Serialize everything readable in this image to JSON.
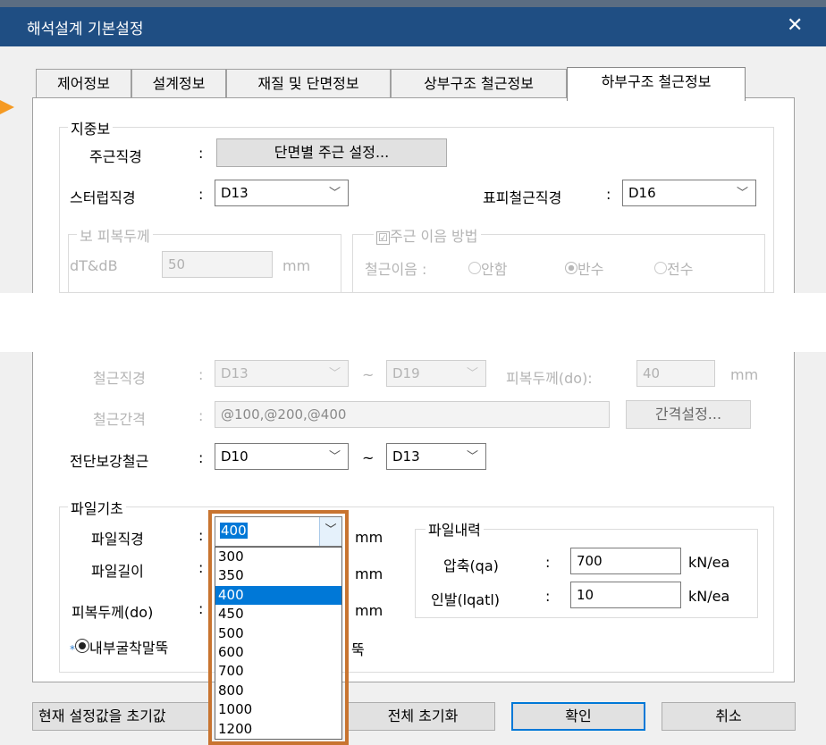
{
  "window": {
    "title": "해석설계 기본설정",
    "close_icon": "close-icon"
  },
  "tabs": [
    {
      "label": "제어정보"
    },
    {
      "label": "설계정보"
    },
    {
      "label": "재질 및 단면정보"
    },
    {
      "label": "상부구조 철근정보"
    },
    {
      "label": "하부구조 철근정보",
      "active": true
    }
  ],
  "girder": {
    "group_title": "지중보",
    "main_bar_label": "주근직경",
    "colon": ":",
    "section_button": "단면별 주근 설정...",
    "stirrup_label": "스터럽직경",
    "stirrup_value": "D13",
    "skin_label": "표피철근직경",
    "skin_value": "D16",
    "cover_group": "보 피복두께",
    "cover_label": "dT&dB",
    "cover_value": "50",
    "cover_unit": "mm",
    "splice_group": "주근 이음 방법",
    "splice_checkbox": "☑",
    "splice_label": "철근이음 :",
    "splice_options": [
      "안함",
      "반수",
      "전수"
    ]
  },
  "rebar": {
    "dia_label": "철근직경",
    "dia_from": "D13",
    "tilde": "~",
    "dia_to": "D19",
    "cover_label": "피복두께(do):",
    "cover_value": "40",
    "cover_unit": "mm",
    "spacing_label": "철근간격",
    "spacing_value": "@100,@200,@400",
    "spacing_button": "간격설정...",
    "shear_label": "전단보강철근",
    "shear_from": "D10",
    "shear_to": "D13"
  },
  "pile": {
    "group_title": "파일기초",
    "dia_label": "파일직경",
    "length_label": "파일길이",
    "cover_label": "피복두께(do)",
    "unit": "mm",
    "selected_value": "400",
    "options": [
      "300",
      "350",
      "400",
      "450",
      "500",
      "600",
      "700",
      "800",
      "1000",
      "1200"
    ],
    "star": "*",
    "radio_label_a": "내부굴착말뚝",
    "radio_label_b": "뚝",
    "capacity": {
      "group_title": "파일내력",
      "compression_label": "압축(qa)",
      "compression_value": "700",
      "uplift_label": "인발(lqatl)",
      "uplift_value": "10",
      "unit": "kN/ea"
    }
  },
  "footer": {
    "reset_current": "현재 설정값을 초기값",
    "reset_all": "전체 초기화",
    "ok": "확인",
    "cancel": "취소"
  },
  "colors": {
    "titlebar": "#1f4e83",
    "selection": "#0078d7",
    "dropdown_highlight": "#c87430",
    "pointer": "#f59a23"
  }
}
